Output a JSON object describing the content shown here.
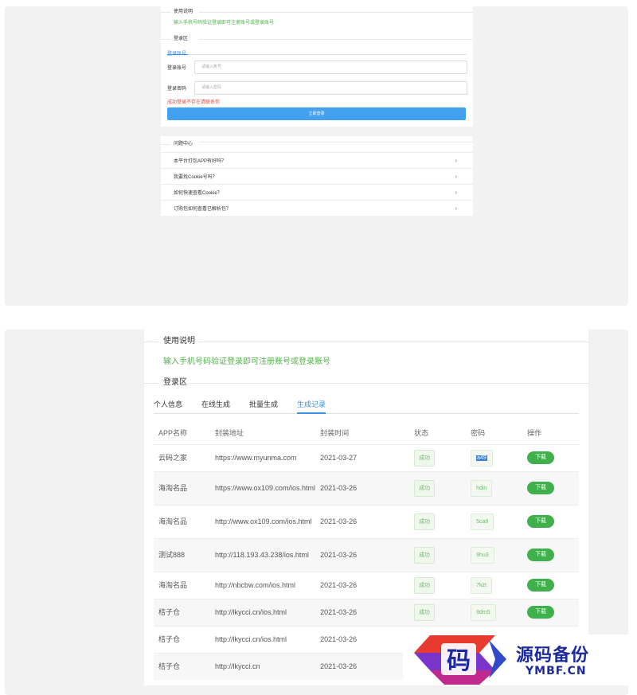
{
  "top_card": {
    "usage_title": "使用说明",
    "usage_text": "输入手机号码验证登录即可注册账号或登录账号",
    "login_title": "登录区",
    "login_tab": "登录账号",
    "account_label": "登录账号",
    "account_placeholder": "请输入账号",
    "password_label": "登录密码",
    "password_placeholder": "请输入密码",
    "error_text": "成功登录不存在请联系你",
    "login_button": "立即登录",
    "faq_title": "问题中心",
    "faq_items": [
      "本平台打包APP有好吗？",
      "我要找Cookie号吗？",
      "如何快速查看Cookie？",
      "订购包如何查看已解析包？"
    ]
  },
  "bottom_card": {
    "usage_title": "使用说明",
    "usage_text": "输入手机号码验证登录即可注册账号或登录账号",
    "login_title": "登录区",
    "tabs": [
      "个人信息",
      "在线生成",
      "批量生成",
      "生成记录"
    ],
    "active_tab": 3,
    "table": {
      "headers": [
        "APP名称",
        "封装地址",
        "封装时间",
        "状态",
        "密码",
        "操作"
      ],
      "rows": [
        {
          "name": "云码之家",
          "url": "https://www.myunma.com",
          "time": "2021-03-27",
          "status": "成功",
          "password": "a49",
          "action": "下载"
        },
        {
          "name": "海淘名品",
          "url": "https://www.ox109.com/ios.html",
          "time": "2021-03-26",
          "status": "成功",
          "password": "hdin",
          "action": "下载"
        },
        {
          "name": "海淘名品",
          "url": "http://www.ox109.com/ios.html",
          "time": "2021-03-26",
          "status": "成功",
          "password": "5ca8",
          "action": "下载"
        },
        {
          "name": "测试888",
          "url": "http://118.193.43.238/ios.html",
          "time": "2021-03-26",
          "status": "成功",
          "password": "9hu3",
          "action": "下载"
        },
        {
          "name": "海淘名品",
          "url": "http://nbcbw.com/ios.html",
          "time": "2021-03-26",
          "status": "成功",
          "password": "7kzt",
          "action": "下载"
        },
        {
          "name": "桔子仓",
          "url": "http://lkycci.cn/ios.html",
          "time": "2021-03-26",
          "status": "成功",
          "password": "9dm5",
          "action": "下载"
        },
        {
          "name": "桔子仓",
          "url": "http://lkycci.cn/ios.html",
          "time": "2021-03-26",
          "status": "",
          "password": "",
          "action": ""
        },
        {
          "name": "桔子仓",
          "url": "http://lkycci.cn",
          "time": "2021-03-26",
          "status": "",
          "password": "",
          "action": ""
        }
      ]
    }
  },
  "watermark": {
    "logo_char": "码",
    "cn": "源码备份",
    "en": "YMBF.CN"
  },
  "colors": {
    "accent_blue": "#3b8eea",
    "success_green": "#52b04a",
    "button_green": "#3fb04b",
    "error_red": "#e0463a",
    "watermark_blue": "#1b2a9c"
  }
}
